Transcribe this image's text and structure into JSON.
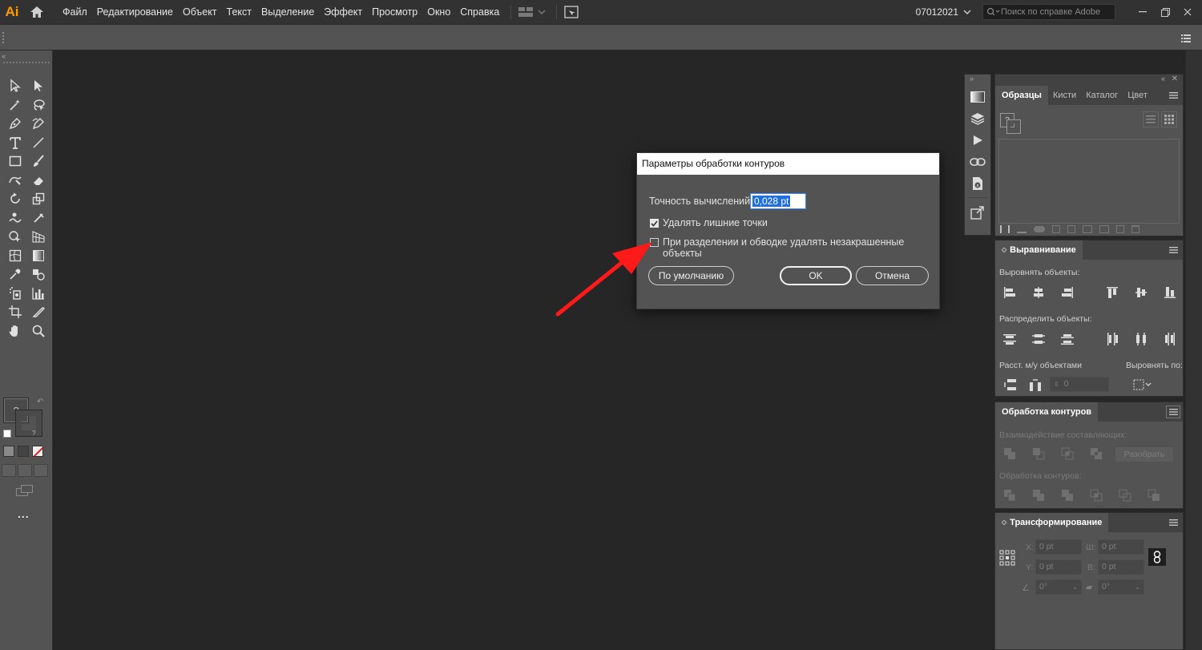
{
  "app": {
    "logo_text": "Ai"
  },
  "menu": [
    "Файл",
    "Редактирование",
    "Объект",
    "Текст",
    "Выделение",
    "Эффект",
    "Просмотр",
    "Окно",
    "Справка"
  ],
  "titlebar": {
    "doc_name": "07012021",
    "search_placeholder": "Поиск по справке Adobe"
  },
  "colors": {
    "accent": "#ff9a00",
    "arrow": "#ff1a1a",
    "selection": "#1f6fe0"
  },
  "toolbar": {
    "tools": [
      "selection-tool",
      "direct-selection-tool",
      "magic-wand-tool",
      "lasso-tool",
      "pen-tool",
      "curvature-tool",
      "type-tool",
      "line-segment-tool",
      "rectangle-tool",
      "paintbrush-tool",
      "shaper-tool",
      "eraser-tool",
      "rotate-tool",
      "scale-tool",
      "warp-tool",
      "free-transform-tool",
      "shape-builder-tool",
      "perspective-grid-tool",
      "mesh-tool",
      "gradient-tool",
      "eyedropper-tool",
      "blend-tool",
      "symbol-sprayer-tool",
      "column-graph-tool",
      "artboard-tool",
      "slice-tool",
      "hand-tool",
      "zoom-tool"
    ],
    "fill_glyph": "?",
    "stroke_glyph": "?",
    "more_label": "..."
  },
  "swatches_panel": {
    "tabs": [
      "Образцы",
      "Кисти",
      "Каталог",
      "Цвет"
    ],
    "active_tab": "Образцы",
    "swatch_glyph": "?"
  },
  "align_panel": {
    "title": "Выравнивание",
    "align_objects_label": "Выровнять объекты:",
    "distribute_objects_label": "Распределить объекты:",
    "distribute_spacing_label": "Расст. м/у объектами",
    "align_to_label": "Выровнять по:",
    "spacing_value": "0"
  },
  "pathfinder_panel": {
    "title": "Обработка контуров",
    "shape_modes_label": "Взаимодействие составляющих:",
    "expand_label": "Разобрать",
    "pathfinders_label": "Обработка контуров:"
  },
  "transform_panel": {
    "title": "Трансформирование",
    "x_label": "X:",
    "x_value": "0 pt",
    "y_label": "Y:",
    "y_value": "0 pt",
    "w_label": "Ш:",
    "w_value": "0 pt",
    "h_label": "В:",
    "h_value": "0 pt",
    "angle_value": "0°",
    "shear_value": "0°"
  },
  "dialog": {
    "title": "Параметры обработки контуров",
    "precision_label": "Точность вычислений:",
    "precision_value": "0,028 pt",
    "remove_points_label": "Удалять лишние точки",
    "remove_points_checked": true,
    "remove_unpainted_label": "При разделении и обводке удалять незакрашенные объекты",
    "remove_unpainted_checked": false,
    "default_button": "По умолчанию",
    "ok_button": "OK",
    "cancel_button": "Отмена"
  }
}
